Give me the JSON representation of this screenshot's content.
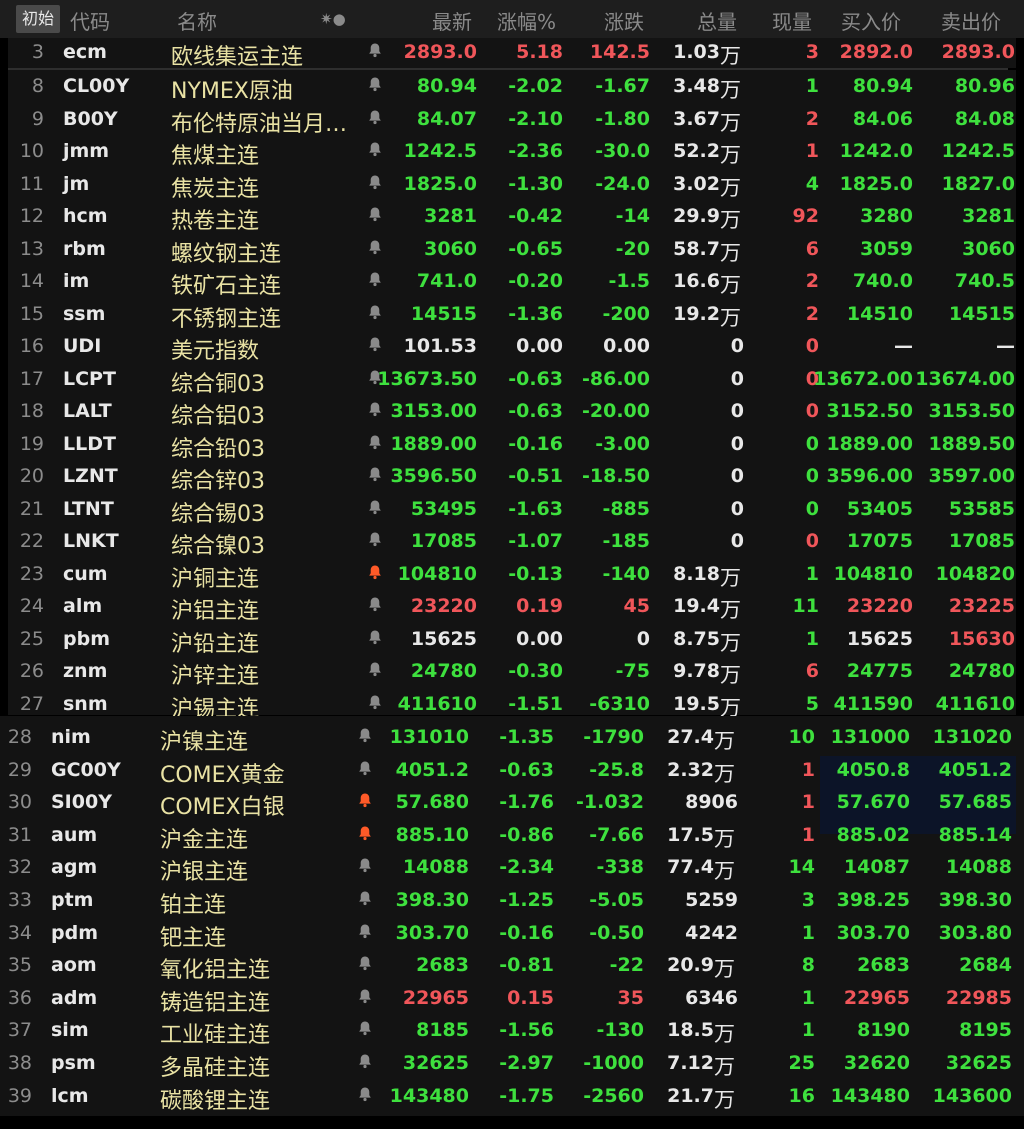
{
  "header": {
    "init_label": "初始",
    "columns": [
      "代码",
      "名称",
      "✷●",
      "最新",
      "涨幅%",
      "涨跌",
      "总量",
      "现量",
      "买入价",
      "卖出价"
    ]
  },
  "colors": {
    "up": "#f0565a",
    "down": "#3ee03e",
    "flat": "#e8e8e8",
    "name": "#e9e2a4",
    "bell_inactive": "#8a8a8a",
    "bell_active": "#ff5a28"
  },
  "top_rows": [
    {
      "idx": "3",
      "code": "ecm",
      "name": "欧线集运主连",
      "bell": "inactive",
      "last": "2893.0",
      "pct": "5.18",
      "chg": "142.5",
      "vol": "1.03",
      "unit": "万",
      "cur": "3",
      "bid": "2892.0",
      "ask": "2893.0",
      "c_last": "up",
      "c_pct": "up",
      "c_chg": "up",
      "c_cur": "up",
      "c_bid": "up",
      "c_ask": "up"
    }
  ],
  "rows_a": [
    {
      "idx": "8",
      "code": "CL00Y",
      "name": "NYMEX原油",
      "bell": "inactive",
      "last": "80.94",
      "pct": "-2.02",
      "chg": "-1.67",
      "vol": "3.48",
      "unit": "万",
      "cur": "1",
      "bid": "80.94",
      "ask": "80.96",
      "c_last": "dn",
      "c_pct": "dn",
      "c_chg": "dn",
      "c_cur": "dn",
      "c_bid": "dn",
      "c_ask": "dn"
    },
    {
      "idx": "9",
      "code": "B00Y",
      "name": "布伦特原油当月…",
      "bell": "inactive",
      "last": "84.07",
      "pct": "-2.10",
      "chg": "-1.80",
      "vol": "3.67",
      "unit": "万",
      "cur": "2",
      "bid": "84.06",
      "ask": "84.08",
      "c_last": "dn",
      "c_pct": "dn",
      "c_chg": "dn",
      "c_cur": "up",
      "c_bid": "dn",
      "c_ask": "dn"
    },
    {
      "idx": "10",
      "code": "jmm",
      "name": "焦煤主连",
      "bell": "inactive",
      "last": "1242.5",
      "pct": "-2.36",
      "chg": "-30.0",
      "vol": "52.2",
      "unit": "万",
      "cur": "1",
      "bid": "1242.0",
      "ask": "1242.5",
      "c_last": "dn",
      "c_pct": "dn",
      "c_chg": "dn",
      "c_cur": "up",
      "c_bid": "dn",
      "c_ask": "dn"
    },
    {
      "idx": "11",
      "code": "jm",
      "name": "焦炭主连",
      "bell": "inactive",
      "last": "1825.0",
      "pct": "-1.30",
      "chg": "-24.0",
      "vol": "3.02",
      "unit": "万",
      "cur": "4",
      "bid": "1825.0",
      "ask": "1827.0",
      "c_last": "dn",
      "c_pct": "dn",
      "c_chg": "dn",
      "c_cur": "dn",
      "c_bid": "dn",
      "c_ask": "dn"
    },
    {
      "idx": "12",
      "code": "hcm",
      "name": "热卷主连",
      "bell": "inactive",
      "last": "3281",
      "pct": "-0.42",
      "chg": "-14",
      "vol": "29.9",
      "unit": "万",
      "cur": "92",
      "bid": "3280",
      "ask": "3281",
      "c_last": "dn",
      "c_pct": "dn",
      "c_chg": "dn",
      "c_cur": "up",
      "c_bid": "dn",
      "c_ask": "dn"
    },
    {
      "idx": "13",
      "code": "rbm",
      "name": "螺纹钢主连",
      "bell": "inactive",
      "last": "3060",
      "pct": "-0.65",
      "chg": "-20",
      "vol": "58.7",
      "unit": "万",
      "cur": "6",
      "bid": "3059",
      "ask": "3060",
      "c_last": "dn",
      "c_pct": "dn",
      "c_chg": "dn",
      "c_cur": "up",
      "c_bid": "dn",
      "c_ask": "dn"
    },
    {
      "idx": "14",
      "code": "im",
      "name": "铁矿石主连",
      "bell": "inactive",
      "last": "741.0",
      "pct": "-0.20",
      "chg": "-1.5",
      "vol": "16.6",
      "unit": "万",
      "cur": "2",
      "bid": "740.0",
      "ask": "740.5",
      "c_last": "dn",
      "c_pct": "dn",
      "c_chg": "dn",
      "c_cur": "up",
      "c_bid": "dn",
      "c_ask": "dn"
    },
    {
      "idx": "15",
      "code": "ssm",
      "name": "不锈钢主连",
      "bell": "inactive",
      "last": "14515",
      "pct": "-1.36",
      "chg": "-200",
      "vol": "19.2",
      "unit": "万",
      "cur": "2",
      "bid": "14510",
      "ask": "14515",
      "c_last": "dn",
      "c_pct": "dn",
      "c_chg": "dn",
      "c_cur": "up",
      "c_bid": "dn",
      "c_ask": "dn"
    },
    {
      "idx": "16",
      "code": "UDI",
      "name": "美元指数",
      "bell": "inactive",
      "last": "101.53",
      "pct": "0.00",
      "chg": "0.00",
      "vol": "0",
      "unit": "",
      "cur": "0",
      "bid": "—",
      "ask": "—",
      "c_last": "fl",
      "c_pct": "fl",
      "c_chg": "fl",
      "c_cur": "up",
      "c_bid": "fl",
      "c_ask": "fl"
    },
    {
      "idx": "17",
      "code": "LCPT",
      "name": "综合铜03",
      "bell": "inactive",
      "last": "13673.50",
      "pct": "-0.63",
      "chg": "-86.00",
      "vol": "0",
      "unit": "",
      "cur": "0",
      "bid": "13672.00",
      "ask": "13674.00",
      "c_last": "dn",
      "c_pct": "dn",
      "c_chg": "dn",
      "c_cur": "up",
      "c_bid": "dn",
      "c_ask": "dn"
    },
    {
      "idx": "18",
      "code": "LALT",
      "name": "综合铝03",
      "bell": "inactive",
      "last": "3153.00",
      "pct": "-0.63",
      "chg": "-20.00",
      "vol": "0",
      "unit": "",
      "cur": "0",
      "bid": "3152.50",
      "ask": "3153.50",
      "c_last": "dn",
      "c_pct": "dn",
      "c_chg": "dn",
      "c_cur": "up",
      "c_bid": "dn",
      "c_ask": "dn"
    },
    {
      "idx": "19",
      "code": "LLDT",
      "name": "综合铅03",
      "bell": "inactive",
      "last": "1889.00",
      "pct": "-0.16",
      "chg": "-3.00",
      "vol": "0",
      "unit": "",
      "cur": "0",
      "bid": "1889.00",
      "ask": "1889.50",
      "c_last": "dn",
      "c_pct": "dn",
      "c_chg": "dn",
      "c_cur": "dn",
      "c_bid": "dn",
      "c_ask": "dn"
    },
    {
      "idx": "20",
      "code": "LZNT",
      "name": "综合锌03",
      "bell": "inactive",
      "last": "3596.50",
      "pct": "-0.51",
      "chg": "-18.50",
      "vol": "0",
      "unit": "",
      "cur": "0",
      "bid": "3596.00",
      "ask": "3597.00",
      "c_last": "dn",
      "c_pct": "dn",
      "c_chg": "dn",
      "c_cur": "dn",
      "c_bid": "dn",
      "c_ask": "dn"
    },
    {
      "idx": "21",
      "code": "LTNT",
      "name": "综合锡03",
      "bell": "inactive",
      "last": "53495",
      "pct": "-1.63",
      "chg": "-885",
      "vol": "0",
      "unit": "",
      "cur": "0",
      "bid": "53405",
      "ask": "53585",
      "c_last": "dn",
      "c_pct": "dn",
      "c_chg": "dn",
      "c_cur": "dn",
      "c_bid": "dn",
      "c_ask": "dn"
    },
    {
      "idx": "22",
      "code": "LNKT",
      "name": "综合镍03",
      "bell": "inactive",
      "last": "17085",
      "pct": "-1.07",
      "chg": "-185",
      "vol": "0",
      "unit": "",
      "cur": "0",
      "bid": "17075",
      "ask": "17085",
      "c_last": "dn",
      "c_pct": "dn",
      "c_chg": "dn",
      "c_cur": "up",
      "c_bid": "dn",
      "c_ask": "dn"
    },
    {
      "idx": "23",
      "code": "cum",
      "name": "沪铜主连",
      "bell": "active",
      "last": "104810",
      "pct": "-0.13",
      "chg": "-140",
      "vol": "8.18",
      "unit": "万",
      "cur": "1",
      "bid": "104810",
      "ask": "104820",
      "c_last": "dn",
      "c_pct": "dn",
      "c_chg": "dn",
      "c_cur": "dn",
      "c_bid": "dn",
      "c_ask": "dn"
    },
    {
      "idx": "24",
      "code": "alm",
      "name": "沪铝主连",
      "bell": "inactive",
      "last": "23220",
      "pct": "0.19",
      "chg": "45",
      "vol": "19.4",
      "unit": "万",
      "cur": "11",
      "bid": "23220",
      "ask": "23225",
      "c_last": "up",
      "c_pct": "up",
      "c_chg": "up",
      "c_cur": "dn",
      "c_bid": "up",
      "c_ask": "up"
    },
    {
      "idx": "25",
      "code": "pbm",
      "name": "沪铅主连",
      "bell": "inactive",
      "last": "15625",
      "pct": "0.00",
      "chg": "0",
      "vol": "8.75",
      "unit": "万",
      "cur": "1",
      "bid": "15625",
      "ask": "15630",
      "c_last": "fl",
      "c_pct": "fl",
      "c_chg": "fl",
      "c_cur": "dn",
      "c_bid": "fl",
      "c_ask": "up"
    },
    {
      "idx": "26",
      "code": "znm",
      "name": "沪锌主连",
      "bell": "inactive",
      "last": "24780",
      "pct": "-0.30",
      "chg": "-75",
      "vol": "9.78",
      "unit": "万",
      "cur": "6",
      "bid": "24775",
      "ask": "24780",
      "c_last": "dn",
      "c_pct": "dn",
      "c_chg": "dn",
      "c_cur": "up",
      "c_bid": "dn",
      "c_ask": "dn"
    },
    {
      "idx": "27",
      "code": "snm",
      "name": "沪锡主连",
      "bell": "inactive",
      "last": "411610",
      "pct": "-1.51",
      "chg": "-6310",
      "vol": "19.5",
      "unit": "万",
      "cur": "5",
      "bid": "411590",
      "ask": "411610",
      "c_last": "dn",
      "c_pct": "dn",
      "c_chg": "dn",
      "c_cur": "dn",
      "c_bid": "dn",
      "c_ask": "dn"
    }
  ],
  "rows_b": [
    {
      "idx": "28",
      "code": "nim",
      "name": "沪镍主连",
      "bell": "inactive",
      "last": "131010",
      "pct": "-1.35",
      "chg": "-1790",
      "vol": "27.4",
      "unit": "万",
      "cur": "10",
      "bid": "131000",
      "ask": "131020",
      "c_last": "dn",
      "c_pct": "dn",
      "c_chg": "dn",
      "c_cur": "dn",
      "c_bid": "dn",
      "c_ask": "dn"
    },
    {
      "idx": "29",
      "code": "GC00Y",
      "name": "COMEX黄金",
      "bell": "inactive",
      "last": "4051.2",
      "pct": "-0.63",
      "chg": "-25.8",
      "vol": "2.32",
      "unit": "万",
      "cur": "1",
      "bid": "4050.8",
      "ask": "4051.2",
      "c_last": "dn",
      "c_pct": "dn",
      "c_chg": "dn",
      "c_cur": "up",
      "c_bid": "dn",
      "c_ask": "dn"
    },
    {
      "idx": "30",
      "code": "SI00Y",
      "name": "COMEX白银",
      "bell": "active",
      "last": "57.680",
      "pct": "-1.76",
      "chg": "-1.032",
      "vol": "8906",
      "unit": "",
      "cur": "1",
      "bid": "57.670",
      "ask": "57.685",
      "c_last": "dn",
      "c_pct": "dn",
      "c_chg": "dn",
      "c_cur": "up",
      "c_bid": "dn",
      "c_ask": "dn"
    },
    {
      "idx": "31",
      "code": "aum",
      "name": "沪金主连",
      "bell": "active",
      "last": "885.10",
      "pct": "-0.86",
      "chg": "-7.66",
      "vol": "17.5",
      "unit": "万",
      "cur": "1",
      "bid": "885.02",
      "ask": "885.14",
      "c_last": "dn",
      "c_pct": "dn",
      "c_chg": "dn",
      "c_cur": "up",
      "c_bid": "dn",
      "c_ask": "dn"
    },
    {
      "idx": "32",
      "code": "agm",
      "name": "沪银主连",
      "bell": "inactive",
      "last": "14088",
      "pct": "-2.34",
      "chg": "-338",
      "vol": "77.4",
      "unit": "万",
      "cur": "14",
      "bid": "14087",
      "ask": "14088",
      "c_last": "dn",
      "c_pct": "dn",
      "c_chg": "dn",
      "c_cur": "dn",
      "c_bid": "dn",
      "c_ask": "dn"
    },
    {
      "idx": "33",
      "code": "ptm",
      "name": "铂主连",
      "bell": "inactive",
      "last": "398.30",
      "pct": "-1.25",
      "chg": "-5.05",
      "vol": "5259",
      "unit": "",
      "cur": "3",
      "bid": "398.25",
      "ask": "398.30",
      "c_last": "dn",
      "c_pct": "dn",
      "c_chg": "dn",
      "c_cur": "dn",
      "c_bid": "dn",
      "c_ask": "dn"
    },
    {
      "idx": "34",
      "code": "pdm",
      "name": "钯主连",
      "bell": "inactive",
      "last": "303.70",
      "pct": "-0.16",
      "chg": "-0.50",
      "vol": "4242",
      "unit": "",
      "cur": "1",
      "bid": "303.70",
      "ask": "303.80",
      "c_last": "dn",
      "c_pct": "dn",
      "c_chg": "dn",
      "c_cur": "dn",
      "c_bid": "dn",
      "c_ask": "dn"
    },
    {
      "idx": "35",
      "code": "aom",
      "name": "氧化铝主连",
      "bell": "inactive",
      "last": "2683",
      "pct": "-0.81",
      "chg": "-22",
      "vol": "20.9",
      "unit": "万",
      "cur": "8",
      "bid": "2683",
      "ask": "2684",
      "c_last": "dn",
      "c_pct": "dn",
      "c_chg": "dn",
      "c_cur": "dn",
      "c_bid": "dn",
      "c_ask": "dn"
    },
    {
      "idx": "36",
      "code": "adm",
      "name": "铸造铝主连",
      "bell": "inactive",
      "last": "22965",
      "pct": "0.15",
      "chg": "35",
      "vol": "6346",
      "unit": "",
      "cur": "1",
      "bid": "22965",
      "ask": "22985",
      "c_last": "up",
      "c_pct": "up",
      "c_chg": "up",
      "c_cur": "dn",
      "c_bid": "up",
      "c_ask": "up"
    },
    {
      "idx": "37",
      "code": "sim",
      "name": "工业硅主连",
      "bell": "inactive",
      "last": "8185",
      "pct": "-1.56",
      "chg": "-130",
      "vol": "18.5",
      "unit": "万",
      "cur": "1",
      "bid": "8190",
      "ask": "8195",
      "c_last": "dn",
      "c_pct": "dn",
      "c_chg": "dn",
      "c_cur": "dn",
      "c_bid": "dn",
      "c_ask": "dn"
    },
    {
      "idx": "38",
      "code": "psm",
      "name": "多晶硅主连",
      "bell": "inactive",
      "last": "32625",
      "pct": "-2.97",
      "chg": "-1000",
      "vol": "7.12",
      "unit": "万",
      "cur": "25",
      "bid": "32620",
      "ask": "32625",
      "c_last": "dn",
      "c_pct": "dn",
      "c_chg": "dn",
      "c_cur": "dn",
      "c_bid": "dn",
      "c_ask": "dn"
    },
    {
      "idx": "39",
      "code": "lcm",
      "name": "碳酸锂主连",
      "bell": "inactive",
      "last": "143480",
      "pct": "-1.75",
      "chg": "-2560",
      "vol": "21.7",
      "unit": "万",
      "cur": "16",
      "bid": "143480",
      "ask": "143600",
      "c_last": "dn",
      "c_pct": "dn",
      "c_chg": "dn",
      "c_cur": "dn",
      "c_bid": "dn",
      "c_ask": "dn"
    }
  ]
}
